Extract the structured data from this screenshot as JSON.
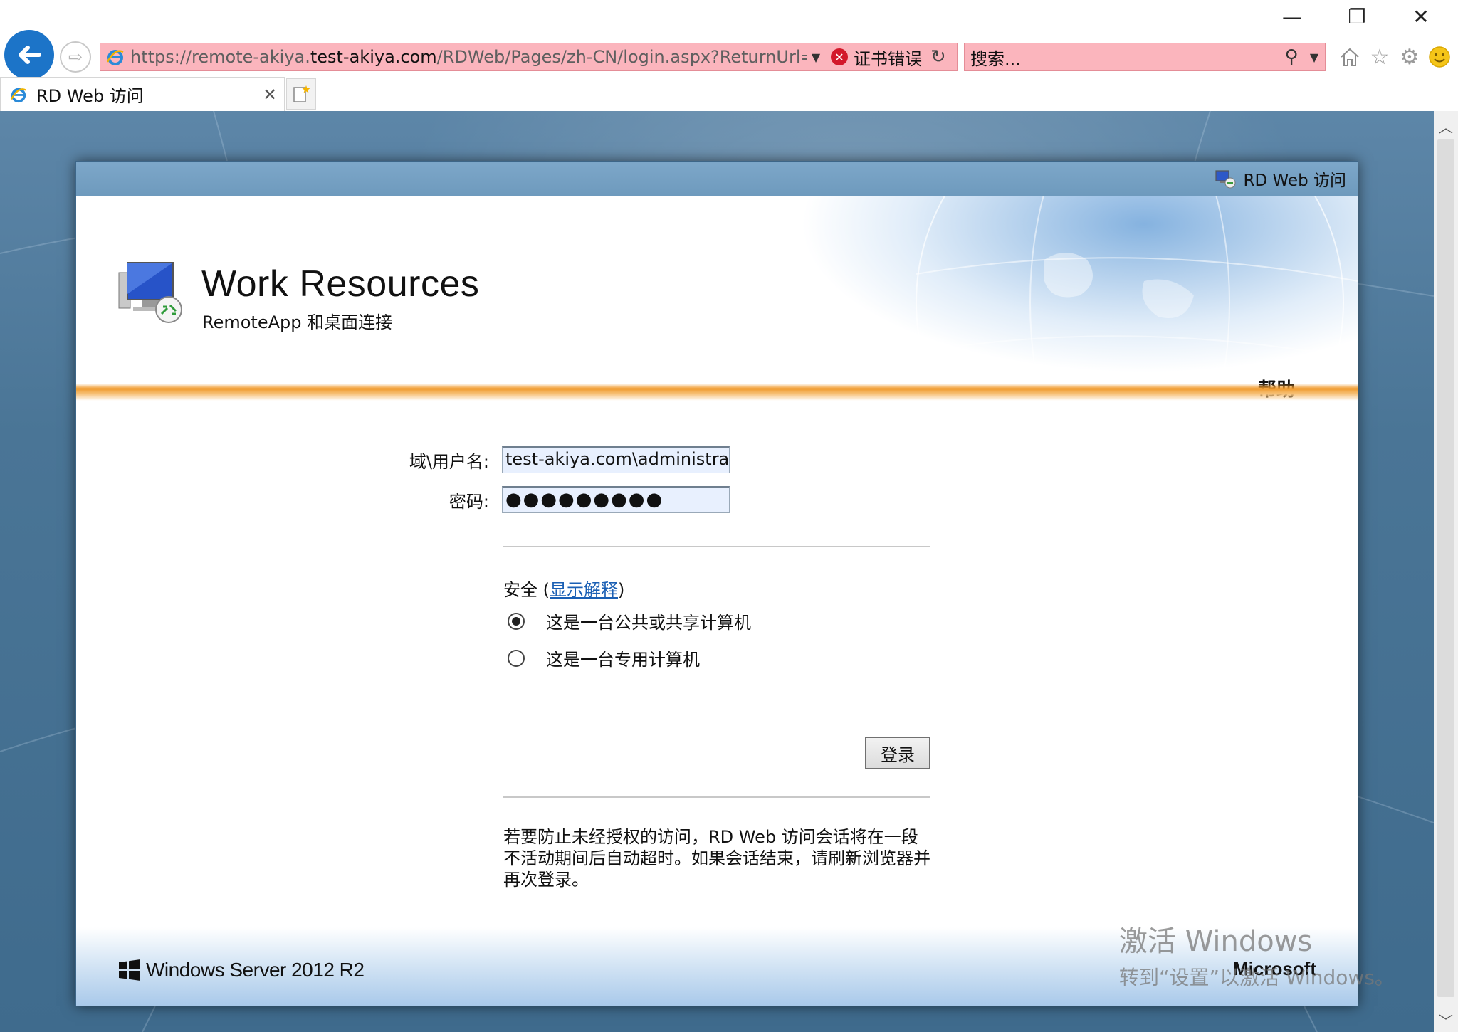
{
  "browser": {
    "window_controls": {
      "minimize": "—",
      "restore": "❐",
      "close": "✕"
    },
    "address": {
      "url_prefix": "https://remote-akiya.",
      "url_domain": "test-akiya.com",
      "url_suffix": "/RDWeb/Pages/zh-CN/login.aspx?ReturnUrl=/R",
      "cert_error": "证书错误"
    },
    "search": {
      "placeholder": "搜索..."
    },
    "tab": {
      "title": "RD Web 访问"
    },
    "colors": {
      "address_error_bg": "#fbb5bd",
      "back_button": "#1c74c8"
    }
  },
  "page": {
    "header_label": "RD Web 访问",
    "app_title": "Work Resources",
    "app_subtitle": "RemoteApp 和桌面连接",
    "help": "帮助",
    "form": {
      "username_label": "域\\用户名:",
      "username_value": "test-akiya.com\\administrator",
      "password_label": "密码:",
      "password_value": "●●●●●●●●●"
    },
    "security": {
      "label_prefix": "安全 (",
      "explain_link": "显示解释",
      "label_suffix": ")",
      "options": [
        {
          "label": "这是一台公共或共享计算机",
          "selected": true
        },
        {
          "label": "这是一台专用计算机",
          "selected": false
        }
      ]
    },
    "login_button": "登录",
    "notice": "若要防止未经授权的访问，RD Web 访问会话将在一段不活动期间后自动超时。如果会话结束，请刷新浏览器并再次登录。",
    "footer": {
      "os_name": "Windows Server 2012 R2",
      "company": "Microsoft"
    },
    "accent_color": "#f09a2c"
  },
  "watermark": {
    "line1": "激活 Windows",
    "line2": "转到“设置”以激活 Windows。"
  }
}
